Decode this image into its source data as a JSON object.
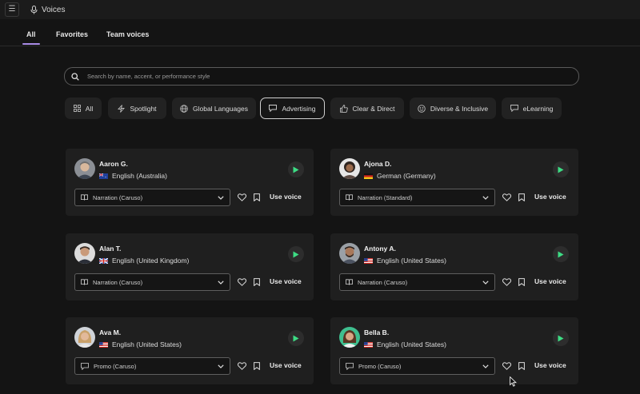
{
  "header": {
    "title": "Voices"
  },
  "tabs": [
    {
      "label": "All",
      "active": true
    },
    {
      "label": "Favorites",
      "active": false
    },
    {
      "label": "Team voices",
      "active": false
    }
  ],
  "search": {
    "placeholder": "Search by name, accent, or performance style",
    "value": ""
  },
  "filters": [
    {
      "label": "All",
      "icon": "grid-icon",
      "active": false
    },
    {
      "label": "Spotlight",
      "icon": "lightning-icon",
      "active": false
    },
    {
      "label": "Global Languages",
      "icon": "globe-icon",
      "active": false
    },
    {
      "label": "Advertising",
      "icon": "megaphone-icon",
      "active": true
    },
    {
      "label": "Clear & Direct",
      "icon": "thumbs-up-icon",
      "active": false
    },
    {
      "label": "Diverse & Inclusive",
      "icon": "smiley-icon",
      "active": false
    },
    {
      "label": "eLearning",
      "icon": "chat-bubble-icon",
      "active": false
    }
  ],
  "voices": [
    {
      "name": "Aaron G.",
      "language": "English (Australia)",
      "flag": "australia",
      "style": "Narration (Caruso)",
      "style_icon": "book-icon",
      "use_label": "Use voice"
    },
    {
      "name": "Ajona D.",
      "language": "German (Germany)",
      "flag": "germany",
      "style": "Narration (Standard)",
      "style_icon": "book-icon",
      "use_label": "Use voice"
    },
    {
      "name": "Alan T.",
      "language": "English (United Kingdom)",
      "flag": "uk",
      "style": "Narration (Caruso)",
      "style_icon": "book-icon",
      "use_label": "Use voice"
    },
    {
      "name": "Antony A.",
      "language": "English (United States)",
      "flag": "usa",
      "style": "Narration (Caruso)",
      "style_icon": "book-icon",
      "use_label": "Use voice"
    },
    {
      "name": "Ava M.",
      "language": "English (United States)",
      "flag": "usa",
      "style": "Promo (Caruso)",
      "style_icon": "megaphone-icon",
      "use_label": "Use voice"
    },
    {
      "name": "Bella B.",
      "language": "English (United States)",
      "flag": "usa",
      "style": "Promo (Caruso)",
      "style_icon": "megaphone-icon",
      "use_label": "Use voice"
    }
  ],
  "colors": {
    "accent": "#a98be6",
    "play": "#3ddc84",
    "background": "#141414",
    "card": "#1f1f1f"
  }
}
